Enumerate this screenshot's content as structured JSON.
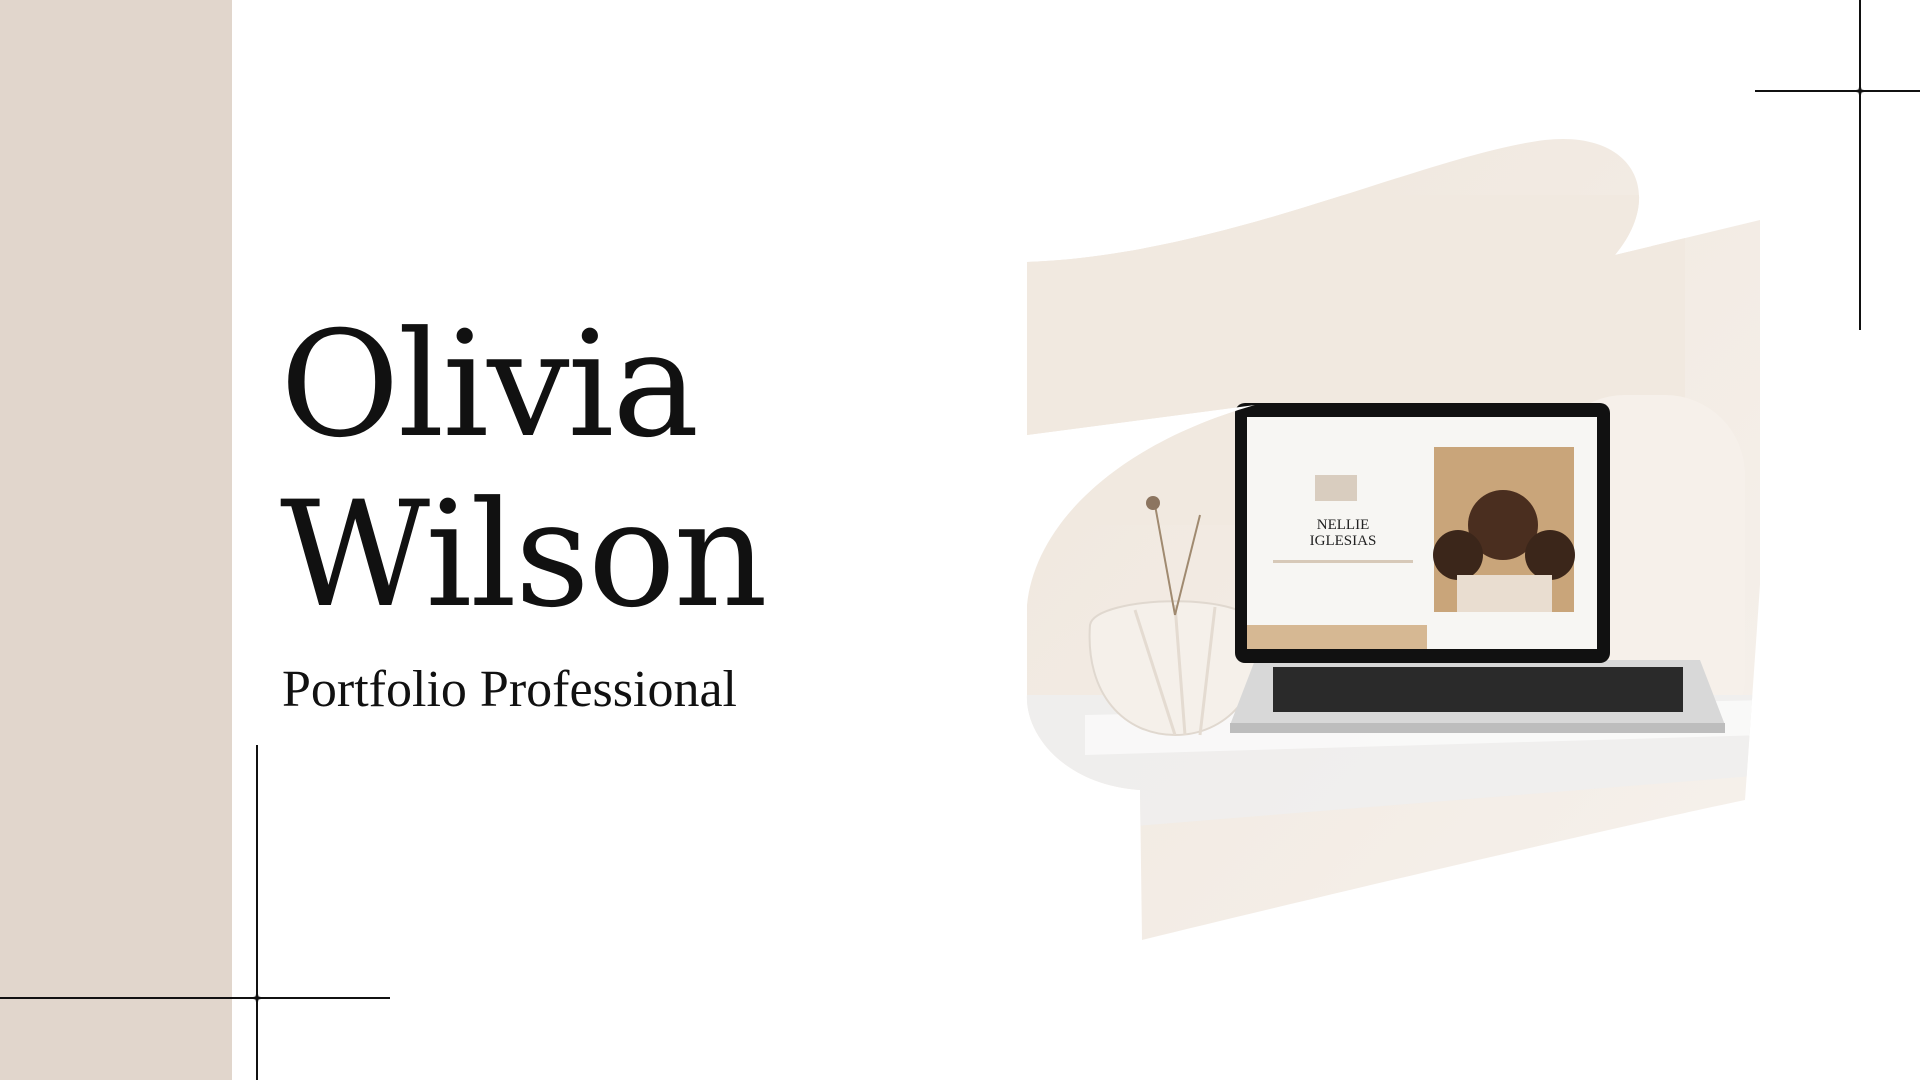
{
  "slide": {
    "name_first": "Olivia",
    "name_last": "Wilson",
    "subtitle": "Portfolio Professional"
  },
  "photo": {
    "description_icon": "laptop-photo",
    "screen_title_line1": "NELLIE",
    "screen_title_line2": "IGLESIAS"
  },
  "colors": {
    "panel": "#e1d6cc",
    "text": "#111111",
    "background": "#ffffff"
  }
}
